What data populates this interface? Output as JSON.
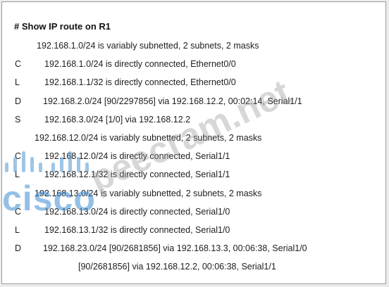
{
  "title": "# Show IP route on R1",
  "routes": [
    {
      "code": "",
      "text": "192.168.1.0/24 is variably subnetted, 2 subnets, 2 masks",
      "indent": "header"
    },
    {
      "code": "C",
      "text": "192.168.1.0/24 is directly connected, Ethernet0/0",
      "indent": "route"
    },
    {
      "code": "L",
      "text": "192.168.1.1/32 is directly connected, Ethernet0/0",
      "indent": "route"
    },
    {
      "code": "D",
      "text": "192.168.2.0/24 [90/2297856] via 192.168.12.2, 00:02:14, Serial1/1",
      "indent": "route-wide"
    },
    {
      "code": "S",
      "text": "192.168.3.0/24 [1/0] via 192.168.12.2",
      "indent": "route"
    },
    {
      "code": "",
      "text": "192.168.12.0/24 is variably subnetted, 2 subnets, 2 masks",
      "indent": "header-left"
    },
    {
      "code": "C",
      "text": "192.168.12.0/24 is directly connected, Serial1/1",
      "indent": "route"
    },
    {
      "code": "L",
      "text": "192.168.12.1/32 is directly connected, Serial1/1",
      "indent": "route"
    },
    {
      "code": "",
      "text": "192.168.13.0/24 is variably subnetted, 2 subnets, 2 masks",
      "indent": "header-left"
    },
    {
      "code": "C",
      "text": "192.168.13.0/24 is directly connected, Serial1/0",
      "indent": "route"
    },
    {
      "code": "L",
      "text": "192.168.13.1/32 is directly connected, Serial1/0",
      "indent": "route"
    },
    {
      "code": "D",
      "text": "192.168.23.0/24 [90/2681856] via 192.168.13.3, 00:06:38, Serial1/0",
      "indent": "route-wide"
    },
    {
      "code": "",
      "text": "[90/2681856] via 192.168.12.2, 00:06:38, Serial1/1",
      "indent": "continuation"
    }
  ],
  "watermarks": {
    "brand": "cisco",
    "site": "peecram.net"
  }
}
